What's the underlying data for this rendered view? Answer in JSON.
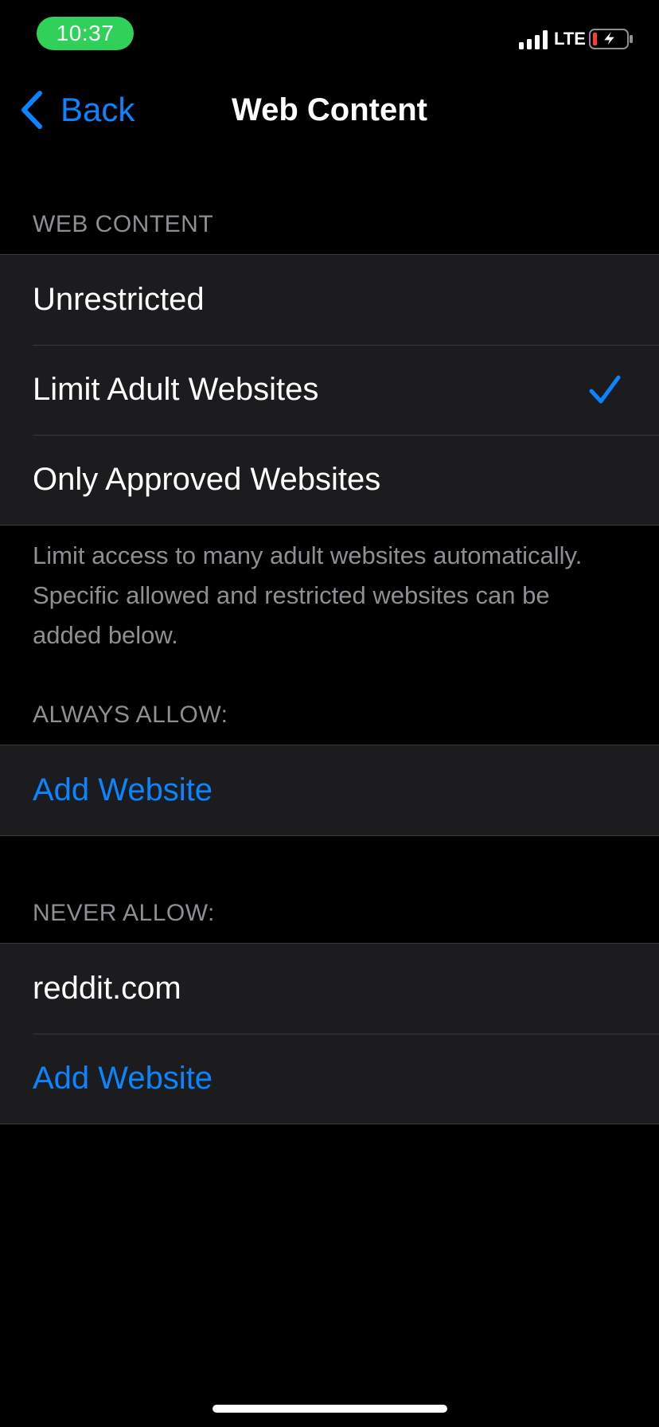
{
  "status_bar": {
    "time": "10:37",
    "network": "LTE",
    "time_pill_color": "#30d158",
    "battery_level_color": "#ff3b30",
    "signal_icon": "cellular-signal-icon",
    "battery_icon": "battery-charging-icon"
  },
  "nav": {
    "back_label": "Back",
    "back_icon": "chevron-left-icon",
    "title": "Web Content"
  },
  "web_content": {
    "header": "WEB CONTENT",
    "options": [
      {
        "label": "Unrestricted",
        "selected": false
      },
      {
        "label": "Limit Adult Websites",
        "selected": true
      },
      {
        "label": "Only Approved Websites",
        "selected": false
      }
    ],
    "checkmark_icon": "checkmark-icon",
    "footer": "Limit access to many adult websites automatically. Specific allowed and restricted websites can be added below."
  },
  "always_allow": {
    "header": "ALWAYS ALLOW:",
    "add_label": "Add Website"
  },
  "never_allow": {
    "header": "NEVER ALLOW:",
    "sites": [
      "reddit.com"
    ],
    "add_label": "Add Website"
  },
  "colors": {
    "accent": "#0a84ff",
    "background": "#000000",
    "cell_background": "#1c1c1e",
    "secondary_text": "#8e8e93",
    "separator": "#38383a"
  }
}
